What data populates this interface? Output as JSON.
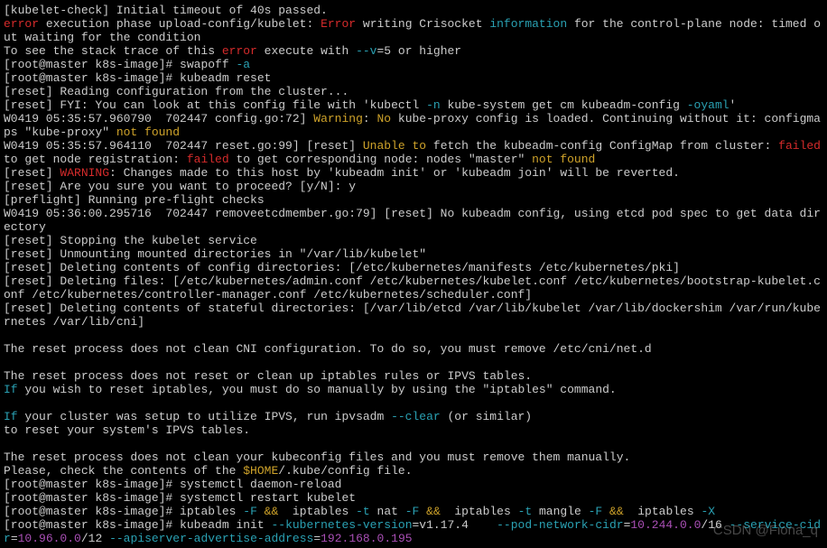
{
  "prompt": "[root@master k8s-image]# ",
  "cmds": {
    "swapoff": "swapoff ",
    "swapoff_arg": "-a",
    "reset": "kubeadm reset",
    "daemon_reload": "systemctl daemon-reload",
    "restart_kubelet": "systemctl restart kubelet",
    "iptables_head": "iptables ",
    "iptables_mid": " iptables ",
    "kubeadm_init": "kubeadm init "
  },
  "lines": {
    "l01": "[kubelet-check] Initial timeout of 40s passed.",
    "l02a": "error",
    "l02b": " execution phase upload-config/kubelet: ",
    "l02c": "Error",
    "l02d": " writing Crisocket ",
    "l02e": "information",
    "l02f": " for the control-plane node: timed out waiting for the condition",
    "l03a": "To see the stack trace of this ",
    "l03b": "error",
    "l03c": " execute with ",
    "l03d": "--v",
    "l03e": "=5 or higher",
    "l06a": "[reset] Reading configuration from the cluster...",
    "l07a": "[reset] FYI: You can look at this config file with 'kubectl ",
    "l07b": "-n",
    "l07c": " kube-system get cm kubeadm-config ",
    "l07d": "-oyaml",
    "l07e": "'",
    "l08a": "W0419 05:35:57.960790  702447 config.go:72] ",
    "l08b": "Warning",
    "l08c": ": ",
    "l08d": "No",
    "l08e": " kube-proxy config is loaded. Continuing without it: configmaps \"kube-proxy\" ",
    "l08f": "not found",
    "l09a": "W0419 05:35:57.964110  702447 reset.go:99] [reset] ",
    "l09b": "Unable to",
    "l09c": " fetch the kubeadm-config ConfigMap from cluster: ",
    "l09d": "failed",
    "l09e": " to get node registration: ",
    "l09f": "failed",
    "l09g": " to get corresponding node: nodes \"master\" ",
    "l09h": "not found",
    "l10a": "[reset] ",
    "l10b": "WARNING",
    "l10c": ": Changes made to this host by 'kubeadm init' or 'kubeadm join' will be reverted.",
    "l11": "[reset] Are you sure you want to proceed? [y/N]: y",
    "l12": "[preflight] Running pre-flight checks",
    "l13": "W0419 05:36:00.295716  702447 removeetcdmember.go:79] [reset] No kubeadm config, using etcd pod spec to get data directory",
    "l14": "[reset] Stopping the kubelet service",
    "l15": "[reset] Unmounting mounted directories in \"/var/lib/kubelet\"",
    "l16": "[reset] Deleting contents of config directories: [/etc/kubernetes/manifests /etc/kubernetes/pki]",
    "l17": "[reset] Deleting files: [/etc/kubernetes/admin.conf /etc/kubernetes/kubelet.conf /etc/kubernetes/bootstrap-kubelet.conf /etc/kubernetes/controller-manager.conf /etc/kubernetes/scheduler.conf]",
    "l18": "[reset] Deleting contents of stateful directories: [/var/lib/etcd /var/lib/kubelet /var/lib/dockershim /var/run/kubernetes /var/lib/cni]",
    "l19": "The reset process does not clean CNI configuration. To do so, you must remove /etc/cni/net.d",
    "l20": "The reset process does not reset or clean up iptables rules or IPVS tables.",
    "l21a": "If",
    "l21b": " you wish to reset iptables, you must do so manually by using the \"iptables\" command.",
    "l22a": "If",
    "l22b": " your cluster was setup to utilize IPVS, run ipvsadm ",
    "l22c": "--clear",
    "l22d": " (or similar)",
    "l23": "to reset your system's IPVS tables.",
    "l24": "The reset process does not clean your kubeconfig files and you must remove them manually.",
    "l25a": "Please, check the contents of the ",
    "l25b": "$HOME",
    "l25c": "/.kube/config file.",
    "ipt_F": "-F",
    "ipt_AA": " && ",
    "ipt_t": "-t",
    "ipt_nat": " nat ",
    "ipt_mangle": " mangle ",
    "ipt_X": "-X",
    "ki_kv": "--kubernetes-version",
    "ki_kv_val": "=v1.17.4    ",
    "ki_pn": "--pod-network-cidr",
    "ki_pn_eq": "=",
    "ki_pn_val": "10.244.0.0",
    "ki_pn_suf": "/16 ",
    "ki_sc": "--service-cidr",
    "ki_sc_eq": "=",
    "ki_sc_val": "10.96.0.0",
    "ki_sc_suf": "/12 ",
    "ki_aa": "--apiserver-advertise-address",
    "ki_aa_eq": "=",
    "ki_aa_val": "192.168.0.195"
  },
  "watermark": "CSDN @Fiona_q"
}
